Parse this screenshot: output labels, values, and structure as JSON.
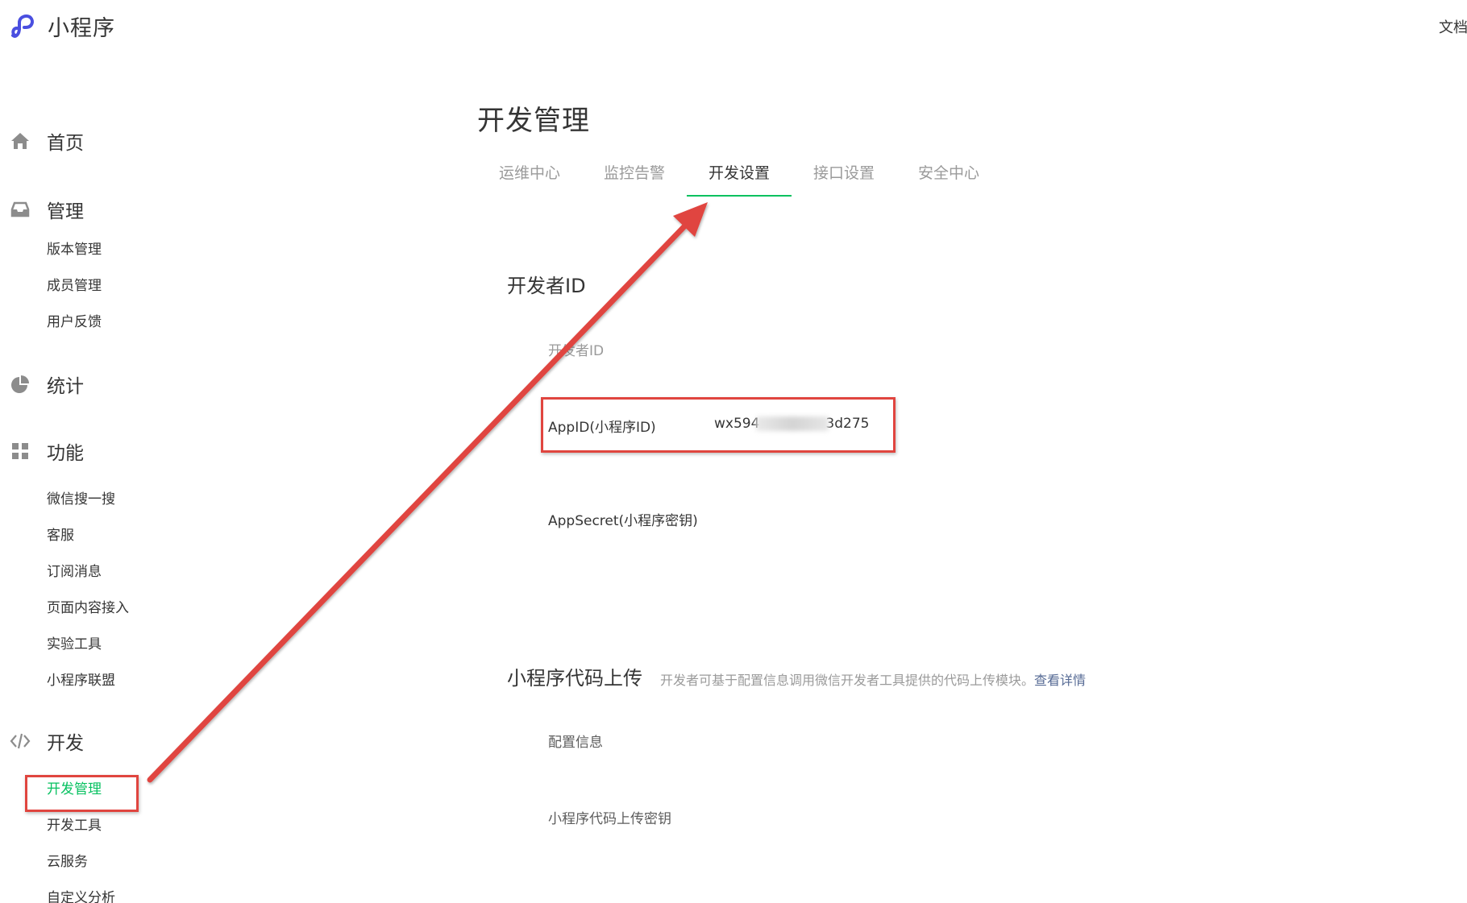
{
  "header": {
    "app_title": "小程序",
    "top_right_link": "文档"
  },
  "sidebar": {
    "groups": [
      {
        "label": "首页",
        "icon": "home-icon"
      },
      {
        "label": "管理",
        "icon": "inbox-icon",
        "items": [
          "版本管理",
          "成员管理",
          "用户反馈"
        ]
      },
      {
        "label": "统计",
        "icon": "pie-chart-icon"
      },
      {
        "label": "功能",
        "icon": "grid-icon",
        "items": [
          "微信搜一搜",
          "客服",
          "订阅消息",
          "页面内容接入",
          "实验工具",
          "小程序联盟"
        ]
      },
      {
        "label": "开发",
        "icon": "code-icon",
        "items": [
          "开发管理",
          "开发工具",
          "云服务",
          "自定义分析"
        ]
      }
    ],
    "active_item": "开发管理"
  },
  "main": {
    "title": "开发管理",
    "tabs": [
      "运维中心",
      "监控告警",
      "开发设置",
      "接口设置",
      "安全中心"
    ],
    "active_tab": "开发设置",
    "developer_id": {
      "section_title": "开发者ID",
      "column_label": "开发者ID",
      "appid_label": "AppID(小程序ID)",
      "appid_value_start": "wx594",
      "appid_value_end": "3d275",
      "appsecret_label": "AppSecret(小程序密钥)"
    },
    "code_upload": {
      "section_title": "小程序代码上传",
      "description": "开发者可基于配置信息调用微信开发者工具提供的代码上传模块。",
      "link": "查看详情",
      "config_label": "配置信息",
      "upload_key_label": "小程序代码上传密钥"
    }
  },
  "colors": {
    "accent_green": "#07c160",
    "annotation_red": "#e0453f",
    "link_blue": "#576b95",
    "logo_blue": "#4a4fe0"
  }
}
